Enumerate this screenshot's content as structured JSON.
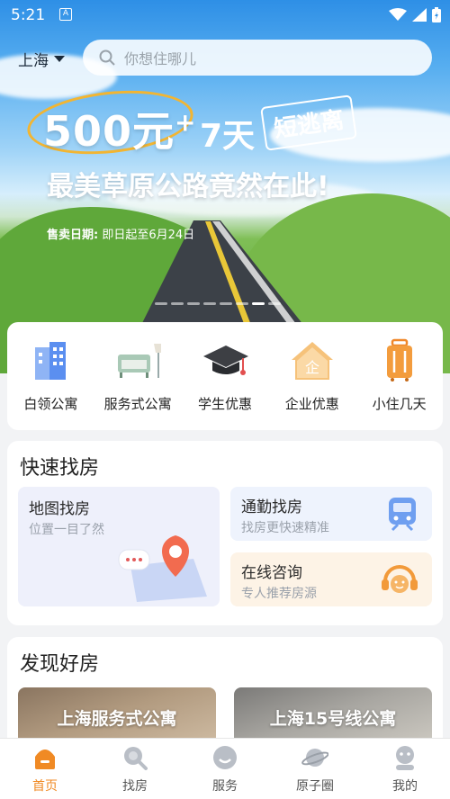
{
  "status_bar": {
    "time": "5:21",
    "notification_icon": "A"
  },
  "header": {
    "city": "上海",
    "search_placeholder": "你想住哪儿"
  },
  "banner": {
    "price": "500元",
    "price_sup": "+",
    "days": "7天",
    "tag": "短逃离",
    "slogan": "最美草原公路竟然在此!",
    "sale_label": "售卖日期:",
    "sale_text": "即日起至6月24日",
    "slide_count": 8,
    "active_slide": 6
  },
  "categories": [
    {
      "label": "白领公寓",
      "icon": "office-building-icon"
    },
    {
      "label": "服务式公寓",
      "icon": "sofa-lamp-icon"
    },
    {
      "label": "学生优惠",
      "icon": "graduation-cap-icon"
    },
    {
      "label": "企业优惠",
      "icon": "enterprise-house-icon"
    },
    {
      "label": "小住几天",
      "icon": "luggage-icon"
    }
  ],
  "quick_find": {
    "title": "快速找房",
    "map": {
      "title": "地图找房",
      "subtitle": "位置一目了然"
    },
    "commute": {
      "title": "通勤找房",
      "subtitle": "找房更快速精准"
    },
    "consult": {
      "title": "在线咨询",
      "subtitle": "专人推荐房源"
    }
  },
  "discover": {
    "title": "发现好房",
    "items": [
      {
        "title": "上海服务式公寓"
      },
      {
        "title": "上海15号线公寓"
      }
    ]
  },
  "tabbar": [
    {
      "label": "首页",
      "icon": "home-icon",
      "active": true
    },
    {
      "label": "找房",
      "icon": "search-icon",
      "active": false
    },
    {
      "label": "服务",
      "icon": "service-icon",
      "active": false
    },
    {
      "label": "原子圈",
      "icon": "planet-icon",
      "active": false
    },
    {
      "label": "我的",
      "icon": "profile-icon",
      "active": false
    }
  ],
  "colors": {
    "accent": "#f08a24",
    "banner_ring": "#f2b532"
  }
}
